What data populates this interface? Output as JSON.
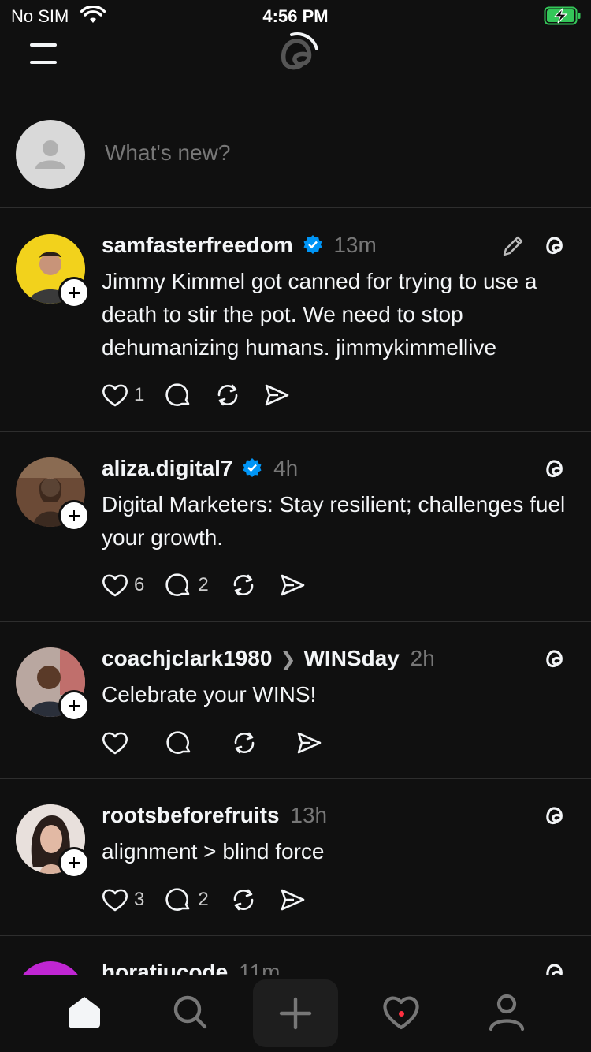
{
  "status_bar": {
    "carrier": "No SIM",
    "time": "4:56 PM"
  },
  "composer": {
    "placeholder": "What's new?"
  },
  "posts": [
    {
      "username": "samfasterfreedom",
      "verified": true,
      "time": "13m",
      "body": "Jimmy Kimmel got canned for trying to use a death to stir the pot. We need to stop dehumanizing humans. jimmykimmellive",
      "likes": "1",
      "replies": "",
      "avatar_color": "#f2d21c"
    },
    {
      "username": "aliza.digital7",
      "verified": true,
      "time": "4h",
      "body": "Digital Marketers: Stay resilient; challenges fuel your growth.",
      "likes": "6",
      "replies": "2",
      "avatar_color": "#5a3a2a"
    },
    {
      "username": "coachjclark1980",
      "topic": "WINSday",
      "time": "2h",
      "body": "Celebrate your WINS!",
      "likes": "",
      "replies": "",
      "avatar_color": "#8a5a4a"
    },
    {
      "username": "rootsbeforefruits",
      "time": "13h",
      "body": "alignment > blind force",
      "likes": "3",
      "replies": "2",
      "avatar_color": "#d9c6c0"
    },
    {
      "username": "horatiucode",
      "time": "11m",
      "avatar_color": "#c026d3"
    }
  ],
  "colors": {
    "background": "#101010",
    "text": "#f3f5f7",
    "muted": "#777777",
    "verified": "#0095f6",
    "notification": "#ff3040"
  },
  "icons": {
    "menu": "menu-icon",
    "logo": "threads-logo",
    "like": "heart-icon",
    "reply": "comment-icon",
    "repost": "repost-icon",
    "share": "send-icon",
    "edit": "pencil-icon",
    "nav": [
      "home-icon",
      "search-icon",
      "plus-icon",
      "heart-icon",
      "profile-icon"
    ]
  }
}
